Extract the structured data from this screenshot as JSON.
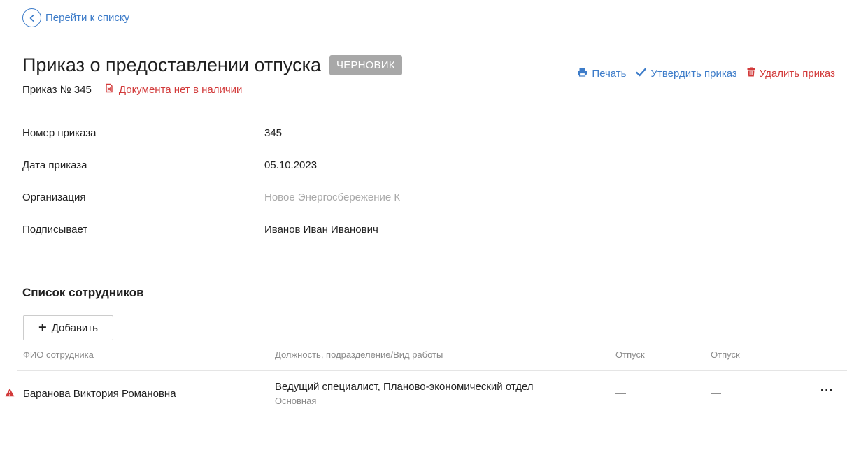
{
  "nav": {
    "back_label": "Перейти к списку"
  },
  "header": {
    "title": "Приказ о предоставлении отпуска",
    "status": "ЧЕРНОВИК",
    "order_number": "Приказ № 345",
    "doc_missing": "Документа нет в наличии"
  },
  "actions": {
    "print": "Печать",
    "approve": "Утвердить приказ",
    "delete": "Удалить приказ"
  },
  "fields": [
    {
      "label": "Номер приказа",
      "value": "345"
    },
    {
      "label": "Дата приказа",
      "value": "05.10.2023"
    },
    {
      "label": "Организация",
      "value": "Новое Энергосбережение К"
    },
    {
      "label": "Подписывает",
      "value": "Иванов Иван Иванович"
    }
  ],
  "employees": {
    "title": "Список сотрудников",
    "add_label": "Добавить",
    "columns": [
      "ФИО сотрудника",
      "Должность, подразделение/Вид работы",
      "Отпуск",
      "Отпуск"
    ],
    "rows": [
      {
        "name": "Баранова Виктория Романовна",
        "position": "Ведущий специалист, Планово-экономический отдел",
        "work_type": "Основная",
        "vacation1": "—",
        "vacation2": "—",
        "more": "···"
      }
    ]
  },
  "colors": {
    "link": "#3d7cc9",
    "danger": "#d23a3a",
    "badge": "#a8a8a8",
    "muted": "#a9a9a9"
  },
  "icons": [
    "chevron-left-icon",
    "document-missing-icon",
    "printer-icon",
    "check-icon",
    "trash-icon",
    "warning-icon"
  ]
}
